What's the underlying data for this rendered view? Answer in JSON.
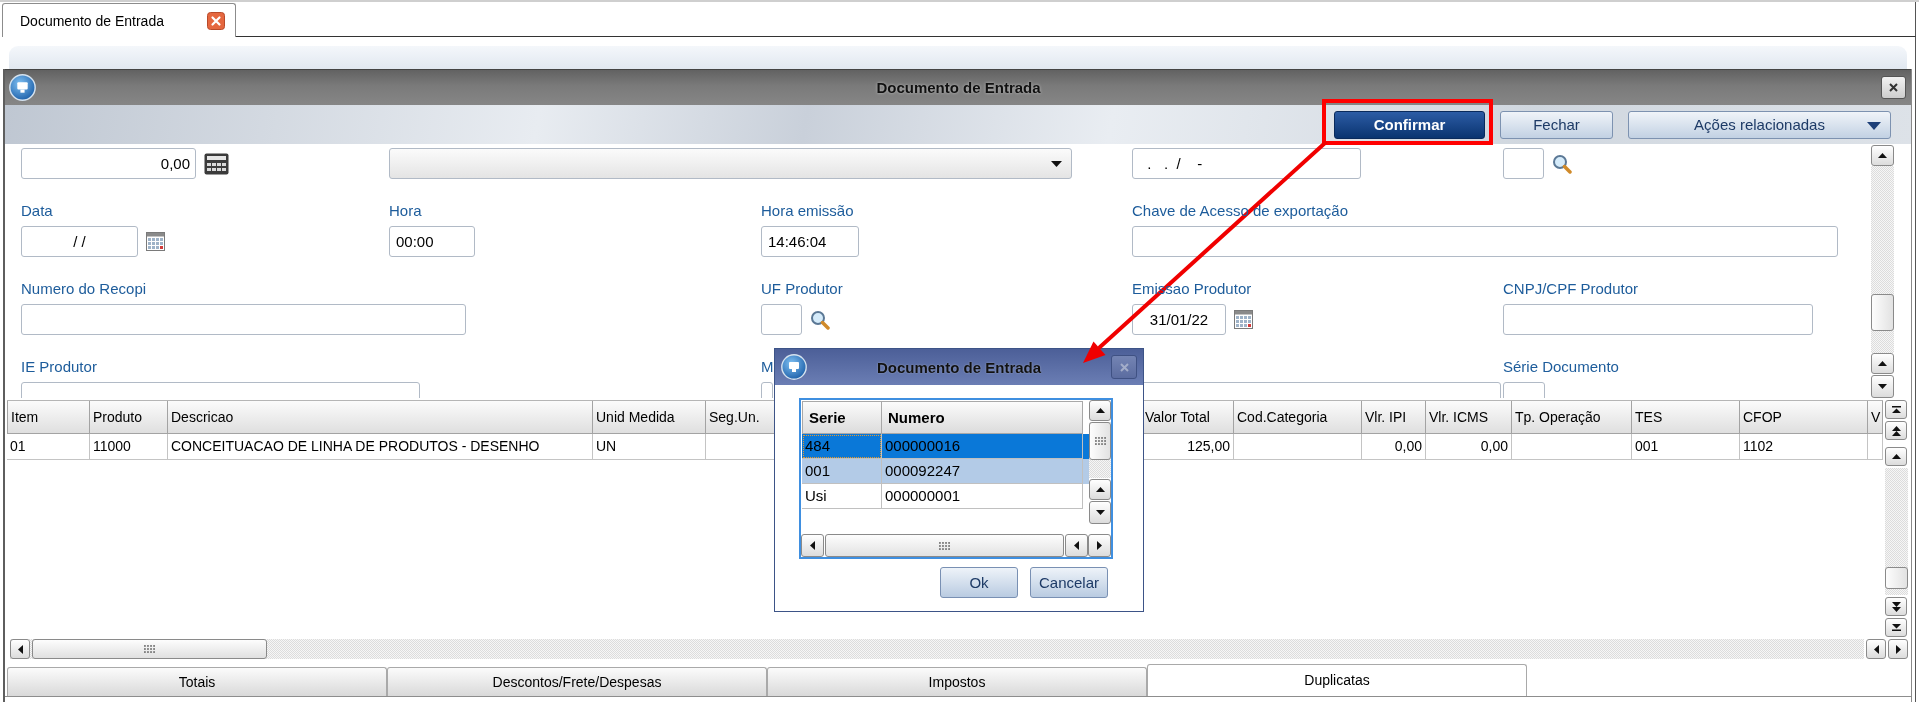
{
  "top_tabs": [
    {
      "label": "Documento de Entrada",
      "selected": true
    }
  ],
  "window": {
    "title": "Documento de Entrada"
  },
  "toolbar": {
    "buttons": [
      {
        "label": "Confirmar",
        "kind": "primary",
        "highlighted": true
      },
      {
        "label": "Fechar",
        "kind": "normal",
        "highlighted": false
      },
      {
        "label": "Ações relacionadas",
        "kind": "menu",
        "highlighted": false
      }
    ]
  },
  "form": {
    "rows": [
      {
        "fields": [
          {
            "kind": "number",
            "value": "0,00"
          },
          {
            "kind": "select"
          },
          {
            "kind": "text",
            "value": "  .   .  /    -"
          },
          {
            "kind": "lookup"
          }
        ]
      },
      {
        "fields": [
          {
            "label": "Data",
            "kind": "date",
            "value": "/ /"
          },
          {
            "label": "Hora",
            "kind": "text",
            "value": "00:00"
          },
          {
            "label": "Hora emissão",
            "kind": "text",
            "value": "14:46:04"
          },
          {
            "label": "Chave de Acesso de exportação",
            "kind": "text"
          }
        ]
      },
      {
        "fields": [
          {
            "label": "Numero do Recopi",
            "kind": "text"
          },
          {
            "label": "UF Produtor",
            "kind": "lookup"
          },
          {
            "label": "Emissao Produtor",
            "kind": "date",
            "value": "31/01/22"
          },
          {
            "label": "CNPJ/CPF Produtor",
            "kind": "text"
          }
        ]
      },
      {
        "fields": [
          {
            "label": "IE Produtor",
            "kind": "text"
          },
          {
            "label": "M",
            "kind": "text"
          },
          {
            "kind": "text"
          },
          {
            "label": "Série Documento",
            "kind": "text"
          }
        ]
      }
    ]
  },
  "items_grid": {
    "columns": [
      {
        "label": "Item",
        "kind": "text"
      },
      {
        "label": "Produto",
        "kind": "text"
      },
      {
        "label": "Descricao",
        "kind": "text"
      },
      {
        "label": "Unid Medida",
        "kind": "text"
      },
      {
        "label": "Seg.Un."
      },
      {
        "label": "Valor Total",
        "kind": "number"
      },
      {
        "label": "Cod.Categoria"
      },
      {
        "label": "Vlr. IPI",
        "kind": "number"
      },
      {
        "label": "Vlr. ICMS",
        "kind": "number"
      },
      {
        "label": "Tp. Operação"
      },
      {
        "label": "TES",
        "kind": "text"
      },
      {
        "label": "CFOP",
        "kind": "text"
      },
      {
        "label": "V"
      }
    ],
    "rows": [
      {
        "cells": [
          "01",
          "11000",
          "CONCEITUACAO DE LINHA DE PRODUTOS - DESENHO",
          "UN",
          null,
          "125,00",
          null,
          "0,00",
          "0,00",
          null,
          "001",
          "1102",
          null
        ]
      }
    ]
  },
  "bottom_tabs": [
    {
      "label": "Totais",
      "selected": false
    },
    {
      "label": "Descontos/Frete/Despesas",
      "selected": false
    },
    {
      "label": "Impostos",
      "selected": false
    },
    {
      "label": "Duplicatas",
      "selected": true
    }
  ],
  "dialog": {
    "title": "Documento de Entrada",
    "columns": [
      "Serie",
      "Numero"
    ],
    "rows": [
      {
        "cells": [
          "484",
          "000000016"
        ],
        "selected": true,
        "focused": true
      },
      {
        "cells": [
          "001",
          "000092247"
        ],
        "selected": true,
        "focused": false
      },
      {
        "cells": [
          "Usi",
          "000000001"
        ],
        "selected": false,
        "focused": false
      }
    ],
    "buttons": [
      "Ok",
      "Cancelar"
    ]
  },
  "annotations": [
    {
      "kind": "arrow"
    }
  ]
}
